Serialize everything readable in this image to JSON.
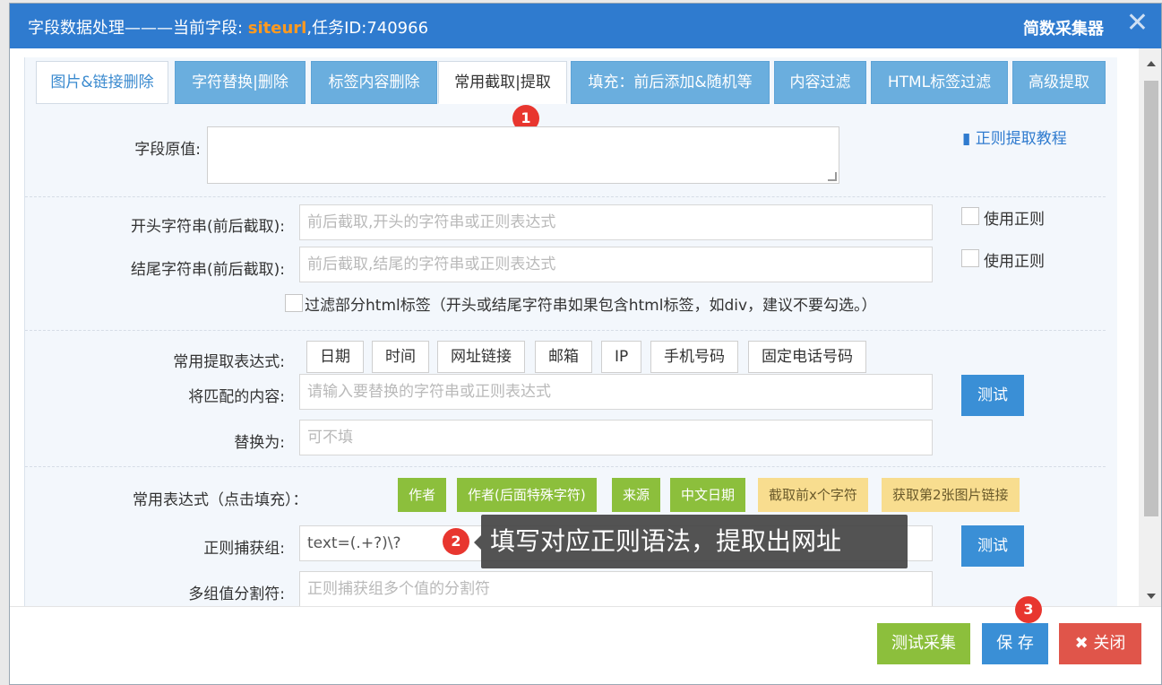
{
  "titlebar": {
    "title_prefix": "字段数据处理———当前字段: ",
    "field_name": "siteurl",
    "task_text": ",任务ID:740966",
    "brand": "简数采集器",
    "close_icon": "close-icon"
  },
  "tabs": [
    {
      "label": "图片&链接删除"
    },
    {
      "label": "字符替换|删除"
    },
    {
      "label": "标签内容删除"
    },
    {
      "label": "常用截取|提取"
    },
    {
      "label": "填充：前后添加&随机等"
    },
    {
      "label": "内容过滤"
    },
    {
      "label": "HTML标签过滤"
    },
    {
      "label": "高级提取"
    }
  ],
  "badges": {
    "one": "1",
    "two": "2",
    "three": "3"
  },
  "form": {
    "original_value_label": "字段原值:",
    "regex_tutorial_link": "正则提取教程",
    "start_string_label": "开头字符串(前后截取):",
    "start_string_placeholder": "前后截取,开头的字符串或正则表达式",
    "end_string_label": "结尾字符串(前后截取):",
    "end_string_placeholder": "前后截取,结尾的字符串或正则表达式",
    "use_regex_label": "使用正则",
    "filter_html_label": "过滤部分html标签（开头或结尾字符串如果包含html标签，如div，建议不要勾选。）",
    "common_extract_label": "常用提取表达式:",
    "common_extract_options": [
      "日期",
      "时间",
      "网址链接",
      "邮箱",
      "IP",
      "手机号码",
      "固定电话号码"
    ],
    "match_label": "将匹配的内容:",
    "match_placeholder": "请输入要替换的字符串或正则表达式",
    "test_label": "测试",
    "replace_label": "替换为:",
    "replace_placeholder": "可不填",
    "common_regex_label": "常用表达式（点击填充）：",
    "regex_chips_green": [
      "作者",
      "作者(后面特殊字符)",
      "来源",
      "中文日期"
    ],
    "regex_chips_yellow": [
      "截取前x个字符",
      "获取第2张图片链接"
    ],
    "capture_group_label": "正则捕获组:",
    "capture_group_value": "text=(.+?)\\?",
    "separator_label": "多组值分割符:",
    "separator_placeholder": "正则捕获组多个值的分割符"
  },
  "tooltip": "填写对应正则语法，提取出网址",
  "footer": {
    "test_collect": "测试采集",
    "save": "保 存",
    "close": "关闭",
    "close_icon": "✖"
  },
  "colors": {
    "titlebar": "#2f7bcf",
    "field_highlight": "#ff9a1f",
    "tab_blue": "#6aaede",
    "btn_blue": "#3a8fd6",
    "btn_green": "#8cbf3c",
    "btn_red": "#e0554a",
    "chip_yellow": "#f8dd8f",
    "badge_red": "#e8362f"
  }
}
